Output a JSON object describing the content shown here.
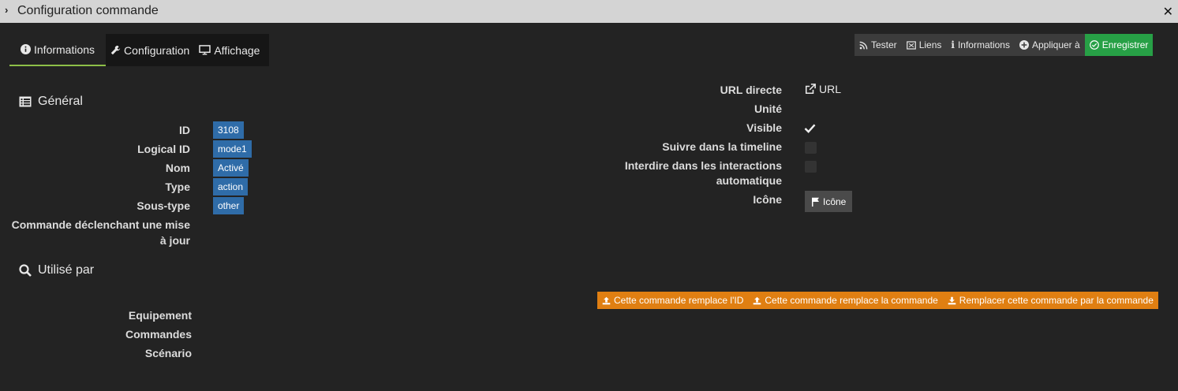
{
  "window": {
    "title": "Configuration commande"
  },
  "tabs": [
    {
      "label": "Informations",
      "icon": "info-circle-icon"
    },
    {
      "label": "Configuration",
      "icon": "wrench-icon"
    },
    {
      "label": "Affichage",
      "icon": "monitor-icon"
    }
  ],
  "toolbar": {
    "tester": "Tester",
    "liens": "Liens",
    "informations": "Informations",
    "appliquer": "Appliquer à",
    "enregistrer": "Enregistrer",
    "enregistrer_color": "#27a046"
  },
  "general": {
    "title": "Général",
    "fields": {
      "id_label": "ID",
      "id_value": "3108",
      "logical_label": "Logical ID",
      "logical_value": "mode1",
      "nom_label": "Nom",
      "nom_value": "Activé",
      "type_label": "Type",
      "type_value": "action",
      "soustype_label": "Sous-type",
      "soustype_value": "other",
      "declenchant_line1": "Commande déclenchant une mise",
      "declenchant_line2": "à jour"
    }
  },
  "right": {
    "url_label": "URL directe",
    "url_link": "URL",
    "unite_label": "Unité",
    "visible_label": "Visible",
    "visible_checked": true,
    "timeline_label": "Suivre dans la timeline",
    "timeline_checked": false,
    "interdire_line1": "Interdire dans les interactions",
    "interdire_line2": "automatique",
    "interdire_checked": false,
    "icone_label": "Icône",
    "icone_button": "Icône"
  },
  "utilise": {
    "title": "Utilisé par",
    "equipement": "Equipement",
    "commandes": "Commandes",
    "scenario": "Scénario"
  },
  "replace": {
    "btn1": "Cette commande remplace l'ID",
    "btn2": "Cette commande remplace la commande",
    "btn3": "Remplacer cette commande par la commande",
    "color": "#e07f12"
  }
}
